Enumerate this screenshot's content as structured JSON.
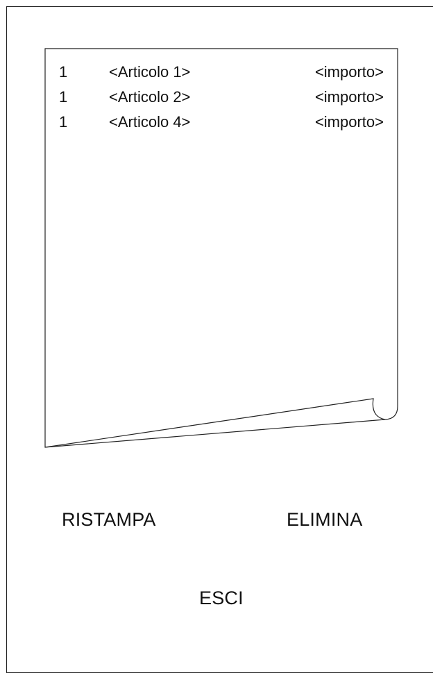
{
  "receipt": {
    "items": [
      {
        "qty": "1",
        "name": "<Articolo 1>",
        "amount": "<importo>"
      },
      {
        "qty": "1",
        "name": "<Articolo 2>",
        "amount": "<importo>"
      },
      {
        "qty": "1",
        "name": "<Articolo 4>",
        "amount": "<importo>"
      }
    ]
  },
  "actions": {
    "reprint_label": "RISTAMPA",
    "delete_label": "ELIMINA",
    "exit_label": "ESCI"
  }
}
